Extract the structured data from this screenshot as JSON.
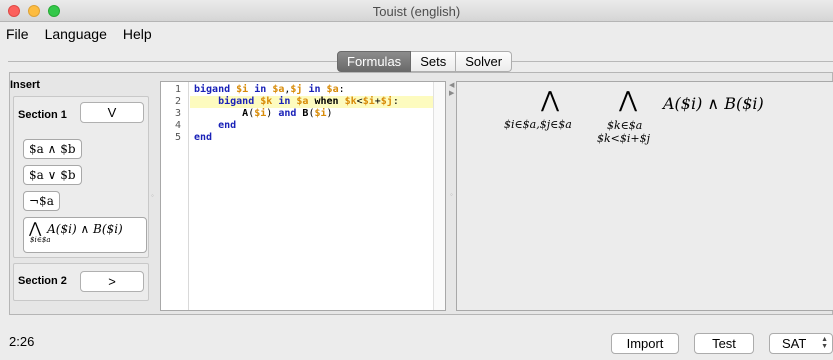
{
  "window": {
    "title": "Touist (english)"
  },
  "menu": [
    "File",
    "Language",
    "Help"
  ],
  "tabs": [
    {
      "label": "Formulas",
      "active": true
    },
    {
      "label": "Sets",
      "active": false
    },
    {
      "label": "Solver",
      "active": false
    }
  ],
  "insert": {
    "title": "Insert",
    "section1": {
      "label": "Section 1",
      "toggle": "V"
    },
    "snippets": [
      "$a ∧ $b",
      "$a ∨ $b",
      "¬$a"
    ],
    "big_snippet": {
      "symbol": "⋀",
      "body": "A($i) ∧ B($i)",
      "subscript": "$i∈$a"
    },
    "section2": {
      "label": "Section 2",
      "toggle": ">"
    }
  },
  "editor": {
    "line_numbers": [
      "1",
      "2",
      "3",
      "4",
      "5"
    ],
    "highlighted_line": 2
  },
  "preview": {
    "sym1": "⋀",
    "sub1": "$i∈$a,$j∈$a",
    "sym2": "⋀",
    "sub2_line1": "$k∈$a",
    "sub2_line2": "$k<$i+$j",
    "body": "A($i) ∧ B($i)"
  },
  "status": {
    "cursor_position": "2:26",
    "import_label": "Import",
    "test_label": "Test",
    "solver_select": "SAT"
  },
  "colors": {
    "keyword": "#1a22b8",
    "variable": "#d88b08",
    "active_tab": "#7a7a7a",
    "line_highlight": "#fdfbbf"
  }
}
